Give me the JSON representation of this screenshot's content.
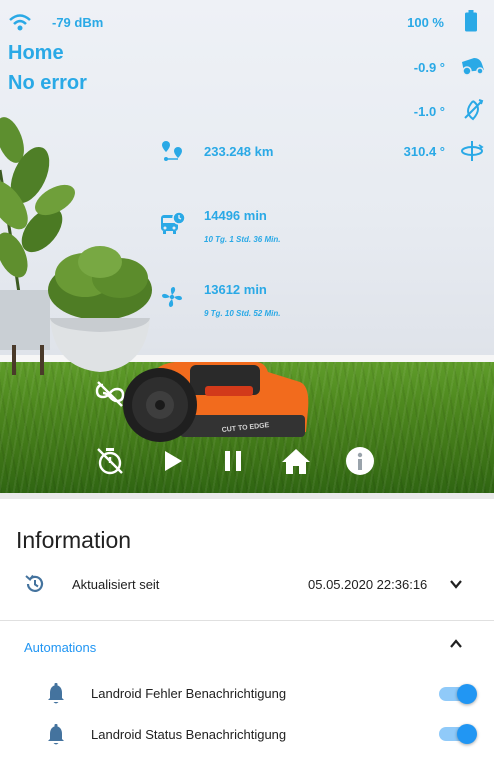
{
  "status": {
    "wifi": "-79 dBm",
    "battery": "100 %",
    "zone": "Home",
    "error": "No error",
    "pitch": "-0.9 °",
    "roll": "-1.0 °",
    "yaw": "310.4 °"
  },
  "stats": {
    "distance": "233.248 km",
    "work_time": "14496 min",
    "work_time_detail": "10 Tg. 1 Std. 36 Min.",
    "blade_time": "13612 min",
    "blade_time_detail": "9 Tg. 10 Std. 52 Min."
  },
  "mower": {
    "brand": "CUT TO EDGE"
  },
  "colors": {
    "accent": "#2aa9e6",
    "mower_orange": "#f26b1d",
    "toggle_on": "#2196f3"
  },
  "controls": [
    "edge-cut-off-icon",
    "timer-off-icon",
    "play-icon",
    "pause-icon",
    "home-icon",
    "info-icon"
  ],
  "info_card": {
    "title": "Information",
    "updated_label": "Aktualisiert seit",
    "updated_value": "05.05.2020 22:36:16",
    "automations_title": "Automations",
    "automations": [
      {
        "label": "Landroid Fehler Benachrichtigung",
        "enabled": true
      },
      {
        "label": "Landroid Status Benachrichtigung",
        "enabled": true
      }
    ]
  }
}
